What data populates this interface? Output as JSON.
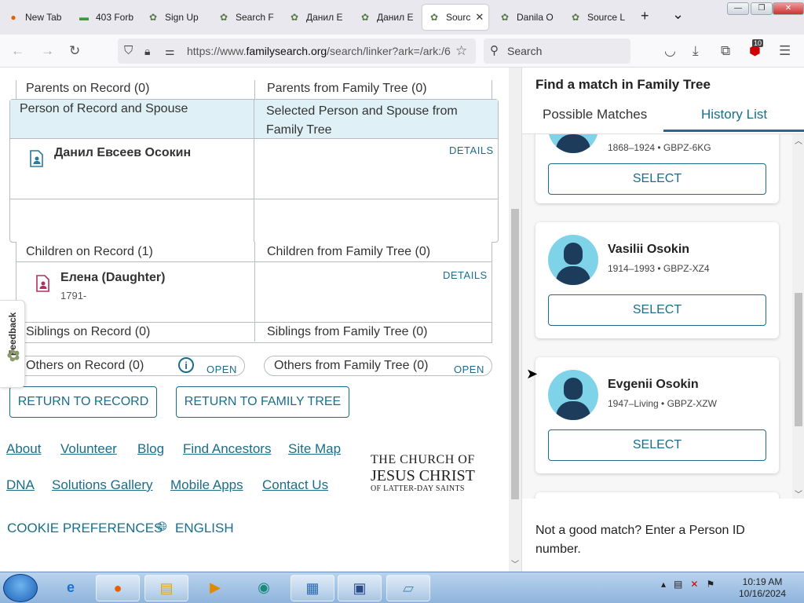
{
  "browser": {
    "tabs": [
      {
        "label": "New Tab"
      },
      {
        "label": "403 Forb"
      },
      {
        "label": "Sign Up"
      },
      {
        "label": "Search F"
      },
      {
        "label": "Данил Е"
      },
      {
        "label": "Данил Е"
      },
      {
        "label": "Sourc"
      },
      {
        "label": "Danila O"
      },
      {
        "label": "Source L"
      }
    ],
    "new_tab": "+",
    "tab_list": "⌄",
    "url_prefix": "https://www.",
    "url_domain": "familysearch.org",
    "url_rest": "/search/linker?ark=/ark:/6",
    "search_placeholder": "Search",
    "extensions_badge": "10"
  },
  "main": {
    "parents": {
      "record_label": "Parents on Record (0)",
      "tree_label": "Parents from Family Tree (0)"
    },
    "spouse_header": {
      "left": "Person of Record and Spouse",
      "right": "Selected Person and Spouse from Family Tree"
    },
    "person": {
      "name": "Данил Евсеев Осокин",
      "details": "DETAILS"
    },
    "children": {
      "record_label": "Children on Record (1)",
      "tree_label": "Children from Family Tree (0)",
      "child_name": "Елена (Daughter)",
      "child_dates": "1791-",
      "details": "DETAILS"
    },
    "siblings": {
      "record_label": "Siblings on Record (0)",
      "tree_label": "Siblings from Family Tree (0)"
    },
    "others": {
      "record_label": "Others on Record (0)",
      "tree_label": "Others from Family Tree (0)",
      "open": "OPEN"
    },
    "buttons": {
      "return_record": "RETURN TO RECORD",
      "return_tree": "RETURN TO FAMILY TREE"
    },
    "feedback": "Feedback"
  },
  "footer": {
    "links_row1": [
      "About",
      "Volunteer",
      "Blog",
      "Find Ancestors",
      "Site Map"
    ],
    "links_row2": [
      "DNA",
      "Solutions Gallery",
      "Mobile Apps",
      "Contact Us"
    ],
    "cookie": "COOKIE PREFERENCES",
    "language": "ENGLISH",
    "church_line1": "THE CHURCH OF",
    "church_line2": "JESUS CHRIST",
    "church_line3": "OF LATTER-DAY SAINTS"
  },
  "sidebar": {
    "title": "Find a match in Family Tree",
    "tab_possible": "Possible Matches",
    "tab_history": "History List",
    "select_label": "SELECT",
    "partial_info": "1868–1924 • GBPZ-6KG",
    "matches": [
      {
        "name": "Vasilii Osokin",
        "info": "1914–1993 • GBPZ-XZ4"
      },
      {
        "name": "Evgenii Osokin",
        "info": "1947–Living • GBPZ-XZW"
      }
    ],
    "bottom_text": "Not a good match? Enter a Person ID number."
  },
  "taskbar": {
    "time": "10:19 AM",
    "date": "10/16/2024"
  },
  "colors": {
    "accent": "#1b6d8a",
    "header_bg": "#dff1f7",
    "avatar_bg": "#7fd3e8"
  }
}
